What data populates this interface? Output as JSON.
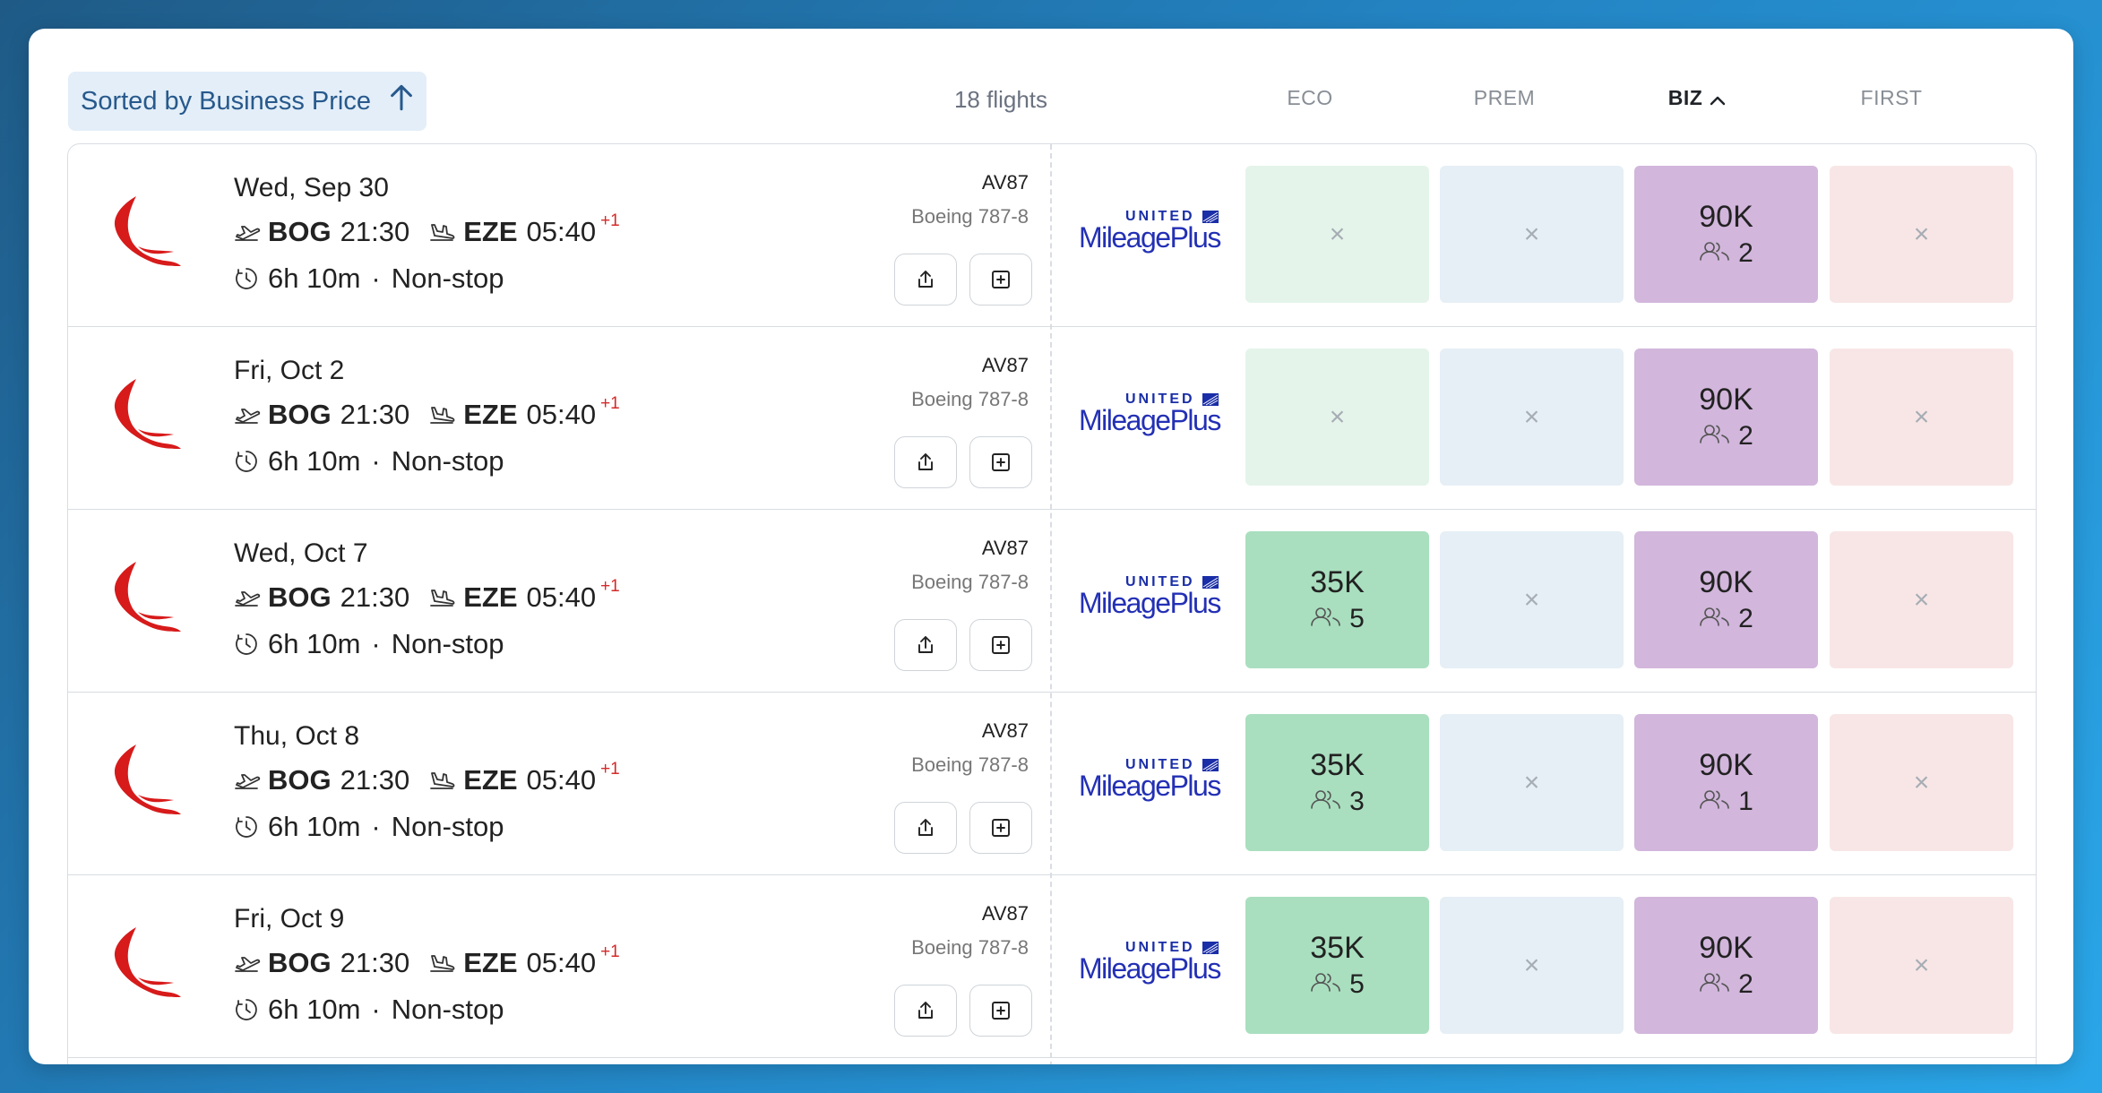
{
  "header": {
    "sort_label": "Sorted by Business Price",
    "flight_count": "18 flights",
    "columns": [
      "ECO",
      "PREM",
      "BIZ",
      "FIRST"
    ],
    "active_column": "BIZ"
  },
  "colors": {
    "eco_available": "#a9dfbf",
    "eco_unavailable": "#e4f4ea",
    "prem_unavailable": "#e6eff6",
    "biz_available": "#d2b6dc",
    "first_unavailable": "#f8e6e6",
    "airline_red": "#d71a1a",
    "program_blue": "#2330b5"
  },
  "program": {
    "brand_small": "UNITED",
    "brand_main": "MileagePlus"
  },
  "flights": [
    {
      "date": "Wed, Sep 30",
      "origin": "BOG",
      "dep": "21:30",
      "dest": "EZE",
      "arr": "05:40",
      "day_offset": "+1",
      "duration": "6h 10m",
      "stops": "Non-stop",
      "flight_no": "AV87",
      "aircraft": "Boeing 787-8",
      "eco": {
        "available": false,
        "mark": "×"
      },
      "prem": {
        "available": false,
        "mark": "×"
      },
      "biz": {
        "available": true,
        "points": "90K",
        "seats": "2"
      },
      "first": {
        "available": false,
        "mark": "×"
      }
    },
    {
      "date": "Fri, Oct 2",
      "origin": "BOG",
      "dep": "21:30",
      "dest": "EZE",
      "arr": "05:40",
      "day_offset": "+1",
      "duration": "6h 10m",
      "stops": "Non-stop",
      "flight_no": "AV87",
      "aircraft": "Boeing 787-8",
      "eco": {
        "available": false,
        "mark": "×"
      },
      "prem": {
        "available": false,
        "mark": "×"
      },
      "biz": {
        "available": true,
        "points": "90K",
        "seats": "2"
      },
      "first": {
        "available": false,
        "mark": "×"
      }
    },
    {
      "date": "Wed, Oct 7",
      "origin": "BOG",
      "dep": "21:30",
      "dest": "EZE",
      "arr": "05:40",
      "day_offset": "+1",
      "duration": "6h 10m",
      "stops": "Non-stop",
      "flight_no": "AV87",
      "aircraft": "Boeing 787-8",
      "eco": {
        "available": true,
        "points": "35K",
        "seats": "5"
      },
      "prem": {
        "available": false,
        "mark": "×"
      },
      "biz": {
        "available": true,
        "points": "90K",
        "seats": "2"
      },
      "first": {
        "available": false,
        "mark": "×"
      }
    },
    {
      "date": "Thu, Oct 8",
      "origin": "BOG",
      "dep": "21:30",
      "dest": "EZE",
      "arr": "05:40",
      "day_offset": "+1",
      "duration": "6h 10m",
      "stops": "Non-stop",
      "flight_no": "AV87",
      "aircraft": "Boeing 787-8",
      "eco": {
        "available": true,
        "points": "35K",
        "seats": "3"
      },
      "prem": {
        "available": false,
        "mark": "×"
      },
      "biz": {
        "available": true,
        "points": "90K",
        "seats": "1"
      },
      "first": {
        "available": false,
        "mark": "×"
      }
    },
    {
      "date": "Fri, Oct 9",
      "origin": "BOG",
      "dep": "21:30",
      "dest": "EZE",
      "arr": "05:40",
      "day_offset": "+1",
      "duration": "6h 10m",
      "stops": "Non-stop",
      "flight_no": "AV87",
      "aircraft": "Boeing 787-8",
      "eco": {
        "available": true,
        "points": "35K",
        "seats": "5"
      },
      "prem": {
        "available": false,
        "mark": "×"
      },
      "biz": {
        "available": true,
        "points": "90K",
        "seats": "2"
      },
      "first": {
        "available": false,
        "mark": "×"
      }
    }
  ]
}
